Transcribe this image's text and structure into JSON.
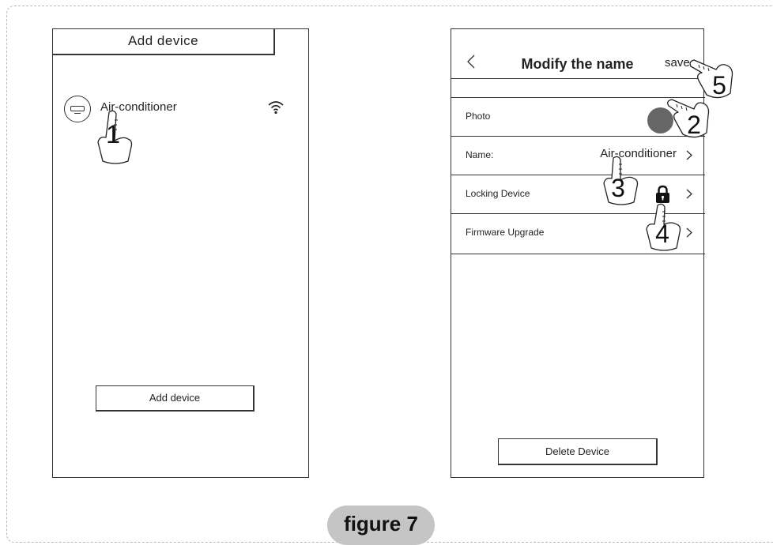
{
  "left_screen": {
    "header_title": "Add device",
    "device_name": "Air-conditioner",
    "button_label": "Add device"
  },
  "right_screen": {
    "title": "Modify the name",
    "save_label": "save",
    "rows": [
      {
        "label": "Photo",
        "value": ""
      },
      {
        "label": "Name:",
        "value": "Air-conditioner"
      },
      {
        "label": "Locking Device",
        "value": ""
      },
      {
        "label": "Firmware Upgrade",
        "value": ""
      }
    ],
    "button_label": "Delete Device"
  },
  "step_markers": [
    "1",
    "2",
    "3",
    "4",
    "5"
  ],
  "caption": "figure 7",
  "icons": [
    "air-conditioner-icon",
    "wifi-icon",
    "back-arrow-icon",
    "chevron-right-icon",
    "lock-icon",
    "pointing-hand-icon"
  ],
  "colors": {
    "line": "#333333",
    "photo_dot": "#666666",
    "caption_bg": "#c5c5c5",
    "frame": "#b9b9b9"
  }
}
